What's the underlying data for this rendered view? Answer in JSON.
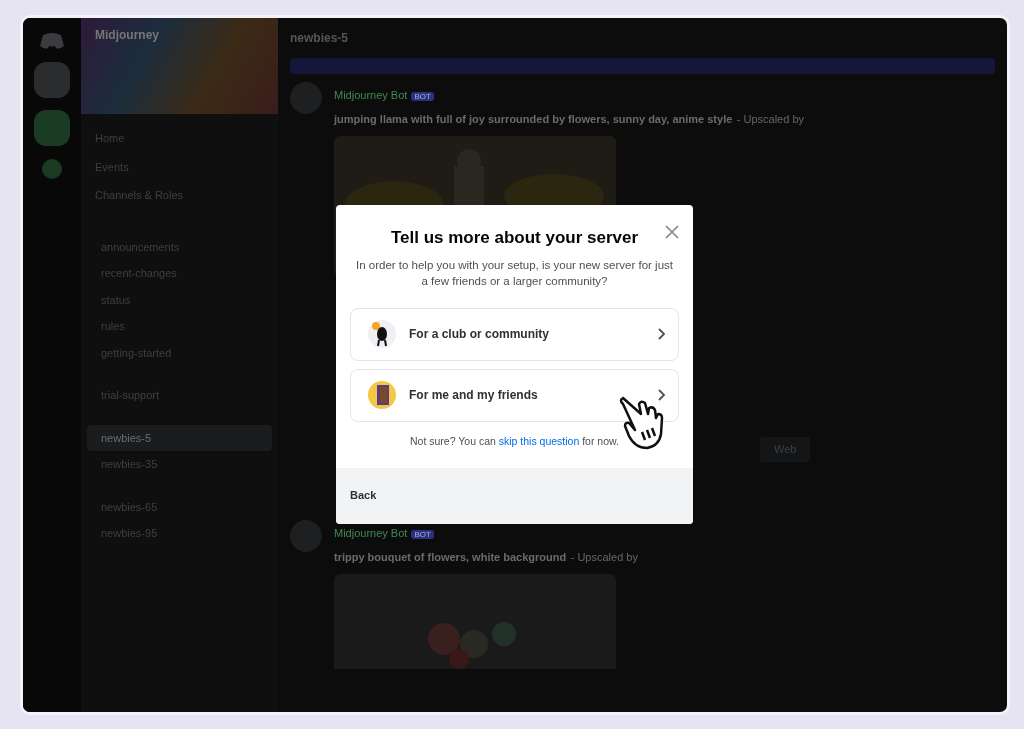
{
  "server": {
    "name": "Midjourney"
  },
  "sidebar": {
    "items": [
      {
        "label": "Home"
      },
      {
        "label": "Events"
      },
      {
        "label": "Channels & Roles"
      }
    ],
    "channels": [
      {
        "label": "announcements",
        "selected": false
      },
      {
        "label": "recent-changes",
        "selected": false
      },
      {
        "label": "status",
        "selected": false
      },
      {
        "label": "rules",
        "selected": false
      },
      {
        "label": "getting-started",
        "selected": false
      },
      {
        "label": "trial-support",
        "selected": false
      },
      {
        "label": "newbies-5",
        "selected": true
      },
      {
        "label": "newbies-35",
        "selected": false
      },
      {
        "label": "newbies-65",
        "selected": false
      },
      {
        "label": "newbies-95",
        "selected": false
      }
    ]
  },
  "header": {
    "channel": "newbies-5"
  },
  "messages": [
    {
      "author": "Midjourney Bot",
      "badge": "BOT",
      "prompt": "jumping llama with full of joy surrounded by flowers, sunny day, anime style",
      "note": "- Upscaled by"
    },
    {
      "author": "Midjourney Bot",
      "badge": "BOT",
      "prompt": "trippy bouquet of flowers, white background",
      "note": "- Upscaled by"
    }
  ],
  "message_buttons": [
    "Web"
  ],
  "modal": {
    "title": "Tell us more about your server",
    "description": "In order to help you with your setup, is your new server for just a few friends or a larger community?",
    "options": [
      {
        "label": "For a club or community",
        "kind": "club"
      },
      {
        "label": "For me and my friends",
        "kind": "friends"
      }
    ],
    "hint_before": "Not sure? You can",
    "hint_link": "skip this question",
    "hint_after": "for now.",
    "back": "Back"
  }
}
